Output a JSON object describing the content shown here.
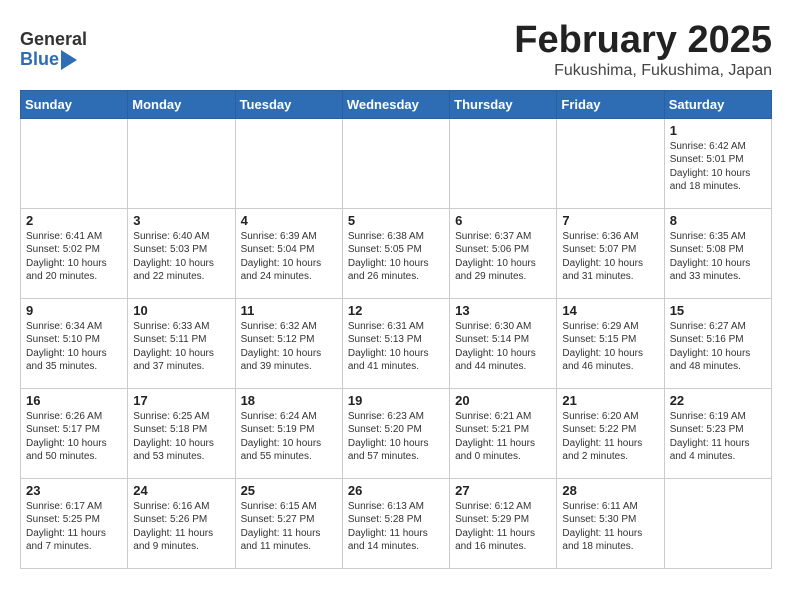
{
  "header": {
    "logo_general": "General",
    "logo_blue": "Blue",
    "month_title": "February 2025",
    "location": "Fukushima, Fukushima, Japan"
  },
  "days_of_week": [
    "Sunday",
    "Monday",
    "Tuesday",
    "Wednesday",
    "Thursday",
    "Friday",
    "Saturday"
  ],
  "weeks": [
    [
      {
        "day": "",
        "info": ""
      },
      {
        "day": "",
        "info": ""
      },
      {
        "day": "",
        "info": ""
      },
      {
        "day": "",
        "info": ""
      },
      {
        "day": "",
        "info": ""
      },
      {
        "day": "",
        "info": ""
      },
      {
        "day": "1",
        "info": "Sunrise: 6:42 AM\nSunset: 5:01 PM\nDaylight: 10 hours and 18 minutes."
      }
    ],
    [
      {
        "day": "2",
        "info": "Sunrise: 6:41 AM\nSunset: 5:02 PM\nDaylight: 10 hours and 20 minutes."
      },
      {
        "day": "3",
        "info": "Sunrise: 6:40 AM\nSunset: 5:03 PM\nDaylight: 10 hours and 22 minutes."
      },
      {
        "day": "4",
        "info": "Sunrise: 6:39 AM\nSunset: 5:04 PM\nDaylight: 10 hours and 24 minutes."
      },
      {
        "day": "5",
        "info": "Sunrise: 6:38 AM\nSunset: 5:05 PM\nDaylight: 10 hours and 26 minutes."
      },
      {
        "day": "6",
        "info": "Sunrise: 6:37 AM\nSunset: 5:06 PM\nDaylight: 10 hours and 29 minutes."
      },
      {
        "day": "7",
        "info": "Sunrise: 6:36 AM\nSunset: 5:07 PM\nDaylight: 10 hours and 31 minutes."
      },
      {
        "day": "8",
        "info": "Sunrise: 6:35 AM\nSunset: 5:08 PM\nDaylight: 10 hours and 33 minutes."
      }
    ],
    [
      {
        "day": "9",
        "info": "Sunrise: 6:34 AM\nSunset: 5:10 PM\nDaylight: 10 hours and 35 minutes."
      },
      {
        "day": "10",
        "info": "Sunrise: 6:33 AM\nSunset: 5:11 PM\nDaylight: 10 hours and 37 minutes."
      },
      {
        "day": "11",
        "info": "Sunrise: 6:32 AM\nSunset: 5:12 PM\nDaylight: 10 hours and 39 minutes."
      },
      {
        "day": "12",
        "info": "Sunrise: 6:31 AM\nSunset: 5:13 PM\nDaylight: 10 hours and 41 minutes."
      },
      {
        "day": "13",
        "info": "Sunrise: 6:30 AM\nSunset: 5:14 PM\nDaylight: 10 hours and 44 minutes."
      },
      {
        "day": "14",
        "info": "Sunrise: 6:29 AM\nSunset: 5:15 PM\nDaylight: 10 hours and 46 minutes."
      },
      {
        "day": "15",
        "info": "Sunrise: 6:27 AM\nSunset: 5:16 PM\nDaylight: 10 hours and 48 minutes."
      }
    ],
    [
      {
        "day": "16",
        "info": "Sunrise: 6:26 AM\nSunset: 5:17 PM\nDaylight: 10 hours and 50 minutes."
      },
      {
        "day": "17",
        "info": "Sunrise: 6:25 AM\nSunset: 5:18 PM\nDaylight: 10 hours and 53 minutes."
      },
      {
        "day": "18",
        "info": "Sunrise: 6:24 AM\nSunset: 5:19 PM\nDaylight: 10 hours and 55 minutes."
      },
      {
        "day": "19",
        "info": "Sunrise: 6:23 AM\nSunset: 5:20 PM\nDaylight: 10 hours and 57 minutes."
      },
      {
        "day": "20",
        "info": "Sunrise: 6:21 AM\nSunset: 5:21 PM\nDaylight: 11 hours and 0 minutes."
      },
      {
        "day": "21",
        "info": "Sunrise: 6:20 AM\nSunset: 5:22 PM\nDaylight: 11 hours and 2 minutes."
      },
      {
        "day": "22",
        "info": "Sunrise: 6:19 AM\nSunset: 5:23 PM\nDaylight: 11 hours and 4 minutes."
      }
    ],
    [
      {
        "day": "23",
        "info": "Sunrise: 6:17 AM\nSunset: 5:25 PM\nDaylight: 11 hours and 7 minutes."
      },
      {
        "day": "24",
        "info": "Sunrise: 6:16 AM\nSunset: 5:26 PM\nDaylight: 11 hours and 9 minutes."
      },
      {
        "day": "25",
        "info": "Sunrise: 6:15 AM\nSunset: 5:27 PM\nDaylight: 11 hours and 11 minutes."
      },
      {
        "day": "26",
        "info": "Sunrise: 6:13 AM\nSunset: 5:28 PM\nDaylight: 11 hours and 14 minutes."
      },
      {
        "day": "27",
        "info": "Sunrise: 6:12 AM\nSunset: 5:29 PM\nDaylight: 11 hours and 16 minutes."
      },
      {
        "day": "28",
        "info": "Sunrise: 6:11 AM\nSunset: 5:30 PM\nDaylight: 11 hours and 18 minutes."
      },
      {
        "day": "",
        "info": ""
      }
    ]
  ]
}
